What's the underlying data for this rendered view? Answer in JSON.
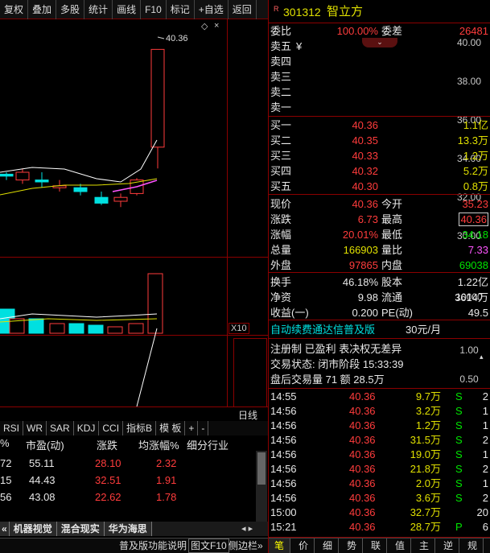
{
  "toolbar": [
    "复权",
    "叠加",
    "多股",
    "统计",
    "画线",
    "F10",
    "标记",
    "+自选",
    "返回"
  ],
  "price_axis": [
    "40.00",
    "38.00",
    "36.00",
    "34.00",
    "32.00",
    "30.00"
  ],
  "price_peak_label": "40.36",
  "volume_axis": "10000",
  "volume_unit": "X10",
  "indicator_axis": [
    "1.00",
    "0.50"
  ],
  "period_label": "日线",
  "indicator_tabs": [
    "RSI",
    "WR",
    "SAR",
    "KDJ",
    "CCI",
    "指标B",
    "模 板",
    "+",
    "-"
  ],
  "table": {
    "headers": [
      "%",
      "市盈(动)",
      "涨跌",
      "均涨幅%",
      "细分行业"
    ],
    "rows": [
      [
        "72",
        "55.11",
        "28.10",
        "2.32"
      ],
      [
        "15",
        "44.43",
        "32.51",
        "1.91"
      ],
      [
        "56",
        "43.08",
        "22.62",
        "1.78"
      ]
    ]
  },
  "bottom_tabs": [
    "机器视觉",
    "混合现实",
    "华为海思"
  ],
  "status_bar": {
    "help": "普及版功能说明",
    "f10": "图文F10",
    "sidebar": "侧边栏»"
  },
  "stock": {
    "flag": "R",
    "code": "301312",
    "name": "智立方"
  },
  "weibi": {
    "label": "委比",
    "value": "100.00%",
    "label2": "委差",
    "value2": "26481"
  },
  "sell": [
    {
      "label": "卖五",
      "price": "¥",
      "vol": ""
    },
    {
      "label": "卖四",
      "price": "",
      "vol": ""
    },
    {
      "label": "卖三",
      "price": "",
      "vol": ""
    },
    {
      "label": "卖二",
      "price": "",
      "vol": ""
    },
    {
      "label": "卖一",
      "price": "",
      "vol": ""
    }
  ],
  "buy": [
    {
      "label": "买一",
      "price": "40.36",
      "vol": "1.1亿"
    },
    {
      "label": "买二",
      "price": "40.35",
      "vol": "13.3万"
    },
    {
      "label": "买三",
      "price": "40.33",
      "vol": "1.2万"
    },
    {
      "label": "买四",
      "price": "40.32",
      "vol": "5.2万"
    },
    {
      "label": "买五",
      "price": "40.30",
      "vol": "0.8万"
    }
  ],
  "quote": [
    {
      "l1": "现价",
      "v1": "40.36",
      "l2": "今开",
      "v2": "35.23"
    },
    {
      "l1": "涨跌",
      "v1": "6.73",
      "l2": "最高",
      "v2": "40.36"
    },
    {
      "l1": "涨幅",
      "v1": "20.01%",
      "l2": "最低",
      "v2": "34.18"
    },
    {
      "l1": "总量",
      "v1": "166903",
      "l2": "量比",
      "v2": "7.33"
    },
    {
      "l1": "外盘",
      "v1": "97865",
      "l2": "内盘",
      "v2": "69038"
    }
  ],
  "fund": [
    {
      "l1": "换手",
      "v1": "46.18%",
      "l2": "股本",
      "v2": "1.22亿"
    },
    {
      "l1": "净资",
      "v1": "9.98",
      "l2": "流通",
      "v2": "3614万"
    },
    {
      "l1": "收益(一)",
      "v1": "0.200",
      "l2": "PE(动)",
      "v2": "49.5"
    }
  ],
  "promo": {
    "text": "自动续费通达信普及版",
    "price": "30元/月"
  },
  "info": {
    "line1": "注册制 已盈利 表决权无差异",
    "line2": "交易状态: 闭市阶段 15:33:39",
    "line3": "盘后交易量 71 额 28.5万"
  },
  "ticks": [
    [
      "14:55",
      "40.36",
      "9.7万",
      "S",
      "2"
    ],
    [
      "14:56",
      "40.36",
      "3.2万",
      "S",
      "1"
    ],
    [
      "14:56",
      "40.36",
      "1.2万",
      "S",
      "1"
    ],
    [
      "14:56",
      "40.36",
      "31.5万",
      "S",
      "2"
    ],
    [
      "14:56",
      "40.36",
      "19.0万",
      "S",
      "1"
    ],
    [
      "14:56",
      "40.36",
      "21.8万",
      "S",
      "2"
    ],
    [
      "14:56",
      "40.36",
      "2.0万",
      "S",
      "1"
    ],
    [
      "14:56",
      "40.36",
      "3.6万",
      "S",
      "2"
    ],
    [
      "15:00",
      "40.36",
      "32.7万",
      "",
      "20"
    ],
    [
      "15:21",
      "40.36",
      "28.7万",
      "P",
      "6"
    ]
  ],
  "nav_tabs": [
    "笔",
    "价",
    "细",
    "势",
    "联",
    "值",
    "主",
    "逆",
    "规"
  ],
  "colors": {
    "up": "#ff3c3c",
    "down": "#00e0e0",
    "border": "#8b0000",
    "ma5": "#ffffff",
    "ma10": "#e0e000",
    "ma20": "#ff55ff"
  }
}
